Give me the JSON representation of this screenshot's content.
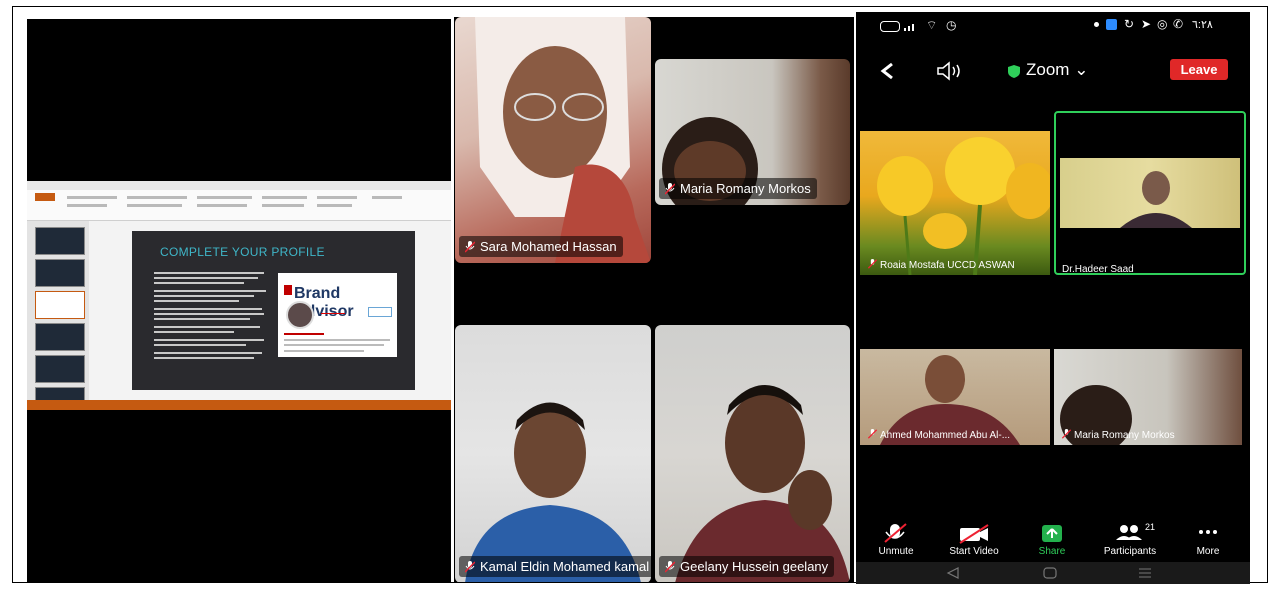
{
  "presentation": {
    "slide_title": "COMPLETE YOUR PROFILE",
    "card_brand": "Brand Advisor"
  },
  "gallery": {
    "participants": [
      {
        "name": "Sara Mohamed Hassan"
      },
      {
        "name": "Maria Romany Morkos"
      },
      {
        "name": "Kamal Eldin Mohamed kamal"
      },
      {
        "name": "Geelany Hussein geelany"
      }
    ]
  },
  "phone": {
    "status_time": "٦:٢٨",
    "app_title": "Zoom",
    "leave_label": "Leave",
    "tiles": [
      {
        "name": "Roaia Mostafa UCCD ASWAN"
      },
      {
        "name": "Dr.Hadeer Saad"
      },
      {
        "name": "Ahmed Mohammed Abu Al-..."
      },
      {
        "name": "Maria Romany Morkos"
      }
    ],
    "toolbar": {
      "unmute": "Unmute",
      "start_video": "Start Video",
      "share": "Share",
      "participants": "Participants",
      "participants_count": "21",
      "more": "More"
    },
    "colors": {
      "leave": "#e02828",
      "share": "#23b14d",
      "active_border": "#2fcf5a"
    }
  }
}
